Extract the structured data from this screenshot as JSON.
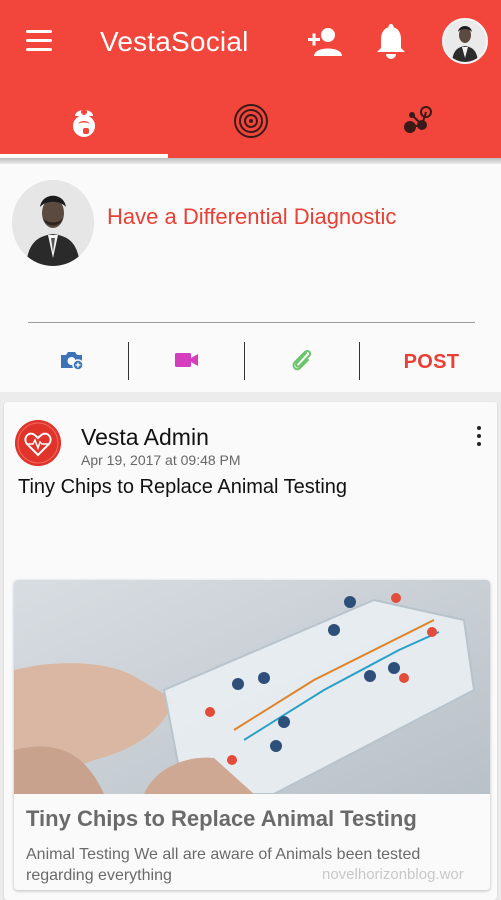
{
  "header": {
    "title": "VestaSocial",
    "icons": [
      "menu-icon",
      "add-user-icon",
      "bell-icon",
      "avatar"
    ]
  },
  "tabs": [
    {
      "icon": "doctor-icon",
      "active": true
    },
    {
      "icon": "target-icon",
      "active": false
    },
    {
      "icon": "network-icon",
      "active": false
    }
  ],
  "composer": {
    "placeholder": "Have a Differential Diagnostic",
    "actions": [
      "camera-icon",
      "video-icon",
      "paperclip-icon"
    ],
    "post_label": "POST"
  },
  "feed": [
    {
      "author": "Vesta Admin",
      "timestamp": "Apr 19, 2017 at 09:48 PM",
      "text": "Tiny Chips to Replace Animal Testing",
      "link": {
        "title": "Tiny Chips to Replace Animal Testing",
        "description": "Animal Testing We all are aware of Animals been tested regarding everything"
      }
    }
  ],
  "watermark": "novelhorizonblog.wor",
  "colors": {
    "primary": "#f2453b",
    "accent_text": "#ea3f34",
    "camera": "#3b73b6",
    "video": "#d43dbd",
    "attach": "#6bc46b"
  }
}
